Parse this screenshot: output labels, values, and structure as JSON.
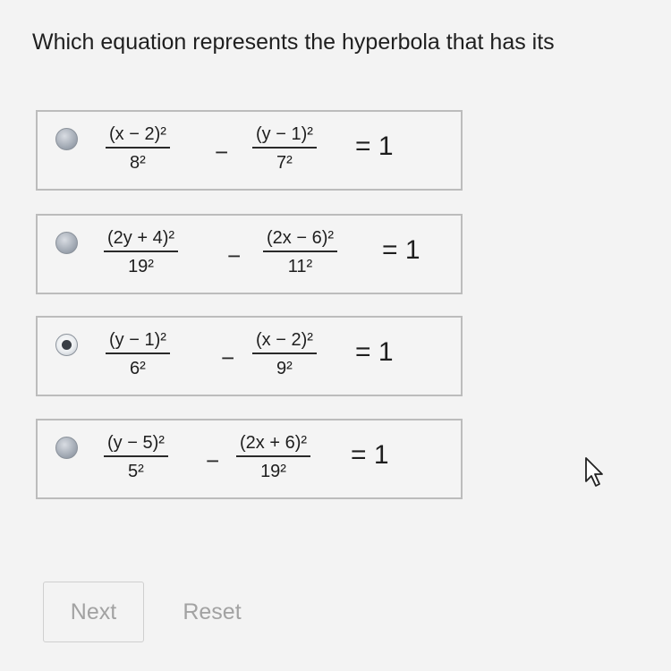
{
  "question": {
    "text": "Which equation represents the hyperbola that has its"
  },
  "options": [
    {
      "checked": false,
      "term1": {
        "num": "(x − 2)²",
        "den": "8²"
      },
      "op": "−",
      "term2": {
        "num": "(y − 1)²",
        "den": "7²"
      },
      "rhs": "= 1"
    },
    {
      "checked": false,
      "term1": {
        "num": "(2y + 4)²",
        "den": "19²"
      },
      "op": "−",
      "term2": {
        "num": "(2x − 6)²",
        "den": "11²"
      },
      "rhs": "= 1"
    },
    {
      "checked": true,
      "term1": {
        "num": "(y − 1)²",
        "den": "6²"
      },
      "op": "−",
      "term2": {
        "num": "(x − 2)²",
        "den": "9²"
      },
      "rhs": "= 1"
    },
    {
      "checked": false,
      "term1": {
        "num": "(y − 5)²",
        "den": "5²"
      },
      "op": "−",
      "term2": {
        "num": "(2x + 6)²",
        "den": "19²"
      },
      "rhs": "= 1"
    }
  ],
  "buttons": {
    "next": "Next",
    "reset": "Reset"
  },
  "icons": {
    "radio": "radio-button-icon",
    "cursor": "mouse-pointer-icon"
  }
}
